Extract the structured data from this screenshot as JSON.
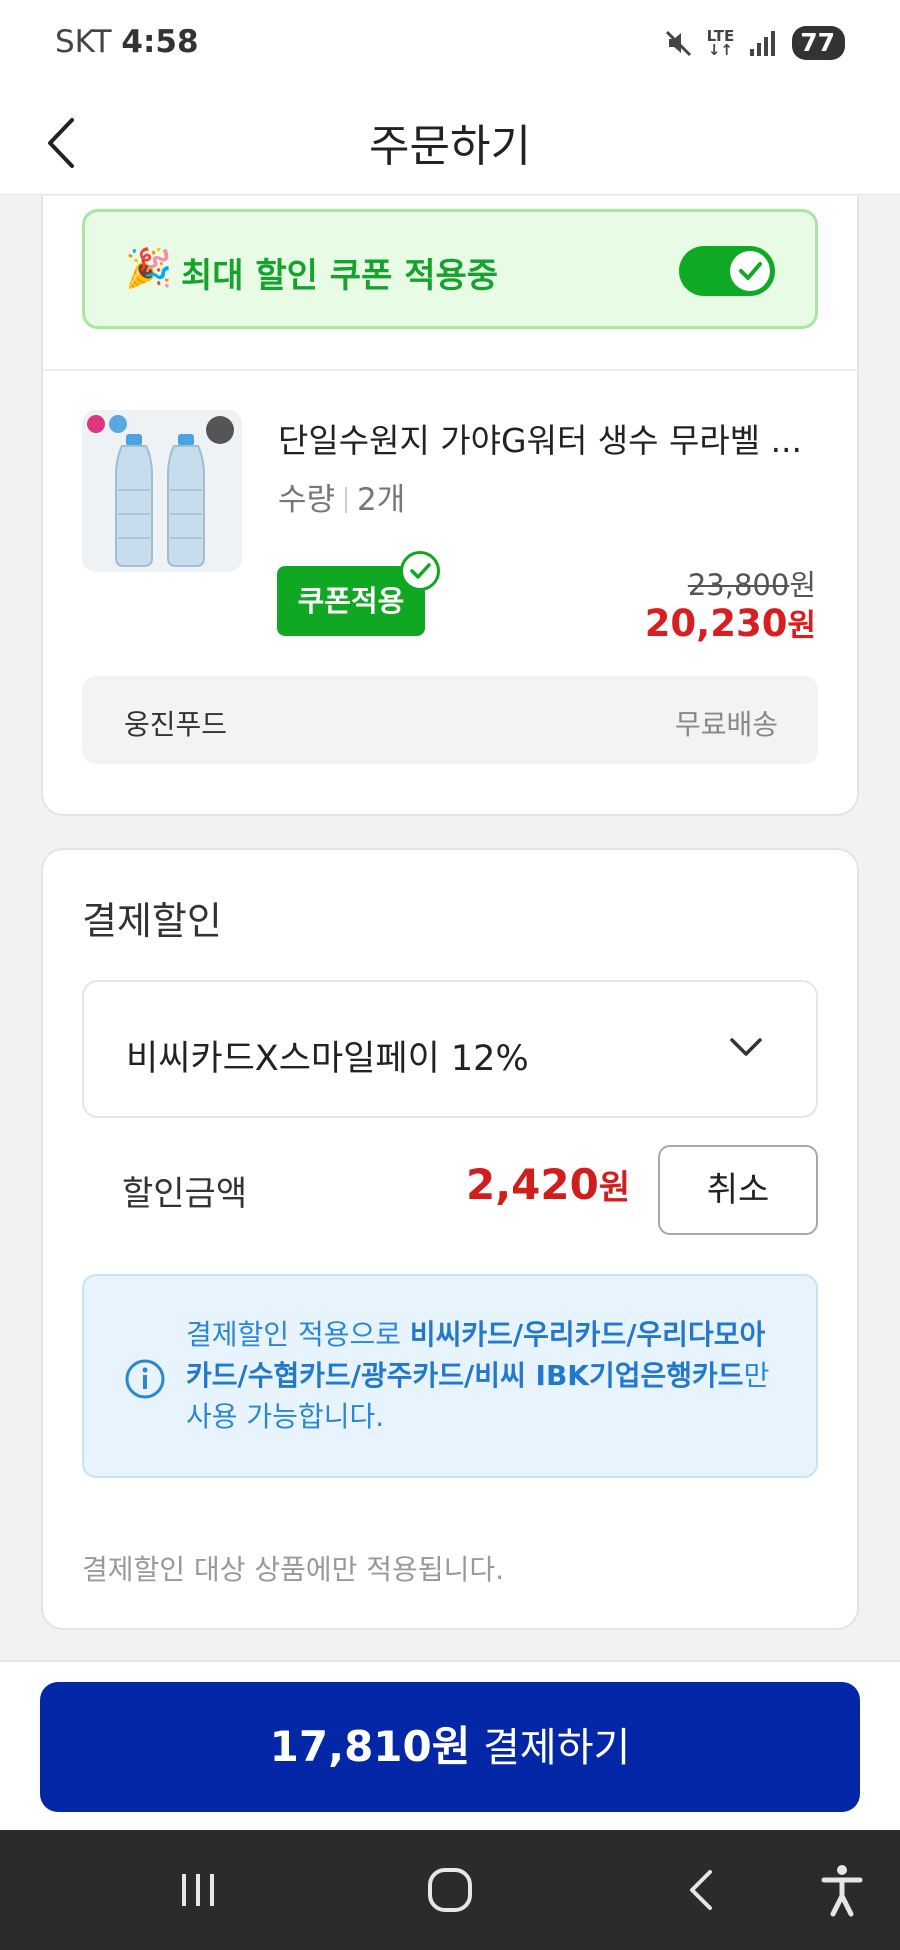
{
  "status_bar": {
    "carrier": "SKT",
    "time": "4:58",
    "network": "LTE",
    "battery": "77"
  },
  "header": {
    "title": "주문하기"
  },
  "coupon_banner": {
    "text": "최대 할인 쿠폰 적용중",
    "toggle_on": true
  },
  "product": {
    "name": "단일수원지 가야G워터 생수 무라벨 ...",
    "qty_label": "수량",
    "qty_value": "2개",
    "coupon_tag": "쿠폰적용",
    "original_price": "23,800",
    "original_unit": "원",
    "sale_price": "20,230",
    "sale_unit": "원",
    "seller": "웅진푸드",
    "shipping": "무료배송"
  },
  "payment_discount": {
    "title": "결제할인",
    "selected_option": "비씨카드X스마일페이 12%",
    "amount_label": "할인금액",
    "amount": "2,420",
    "amount_unit": "원",
    "cancel_label": "취소",
    "info_prefix": "결제할인 적용으로 ",
    "info_cards": "비씨카드/우리카드/우리다모아카드/수협카드/광주카드/비씨 IBK기업은행카드",
    "info_suffix": "만 사용 가능합니다.",
    "footnote": "결제할인 대상 상품에만 적용됩니다."
  },
  "pay_button": {
    "amount": "17,810원",
    "label": "결제하기"
  },
  "colors": {
    "accent_green": "#10a822",
    "price_red": "#d81e1e",
    "pay_blue": "#0327a6",
    "info_blue": "#2c86d6"
  }
}
